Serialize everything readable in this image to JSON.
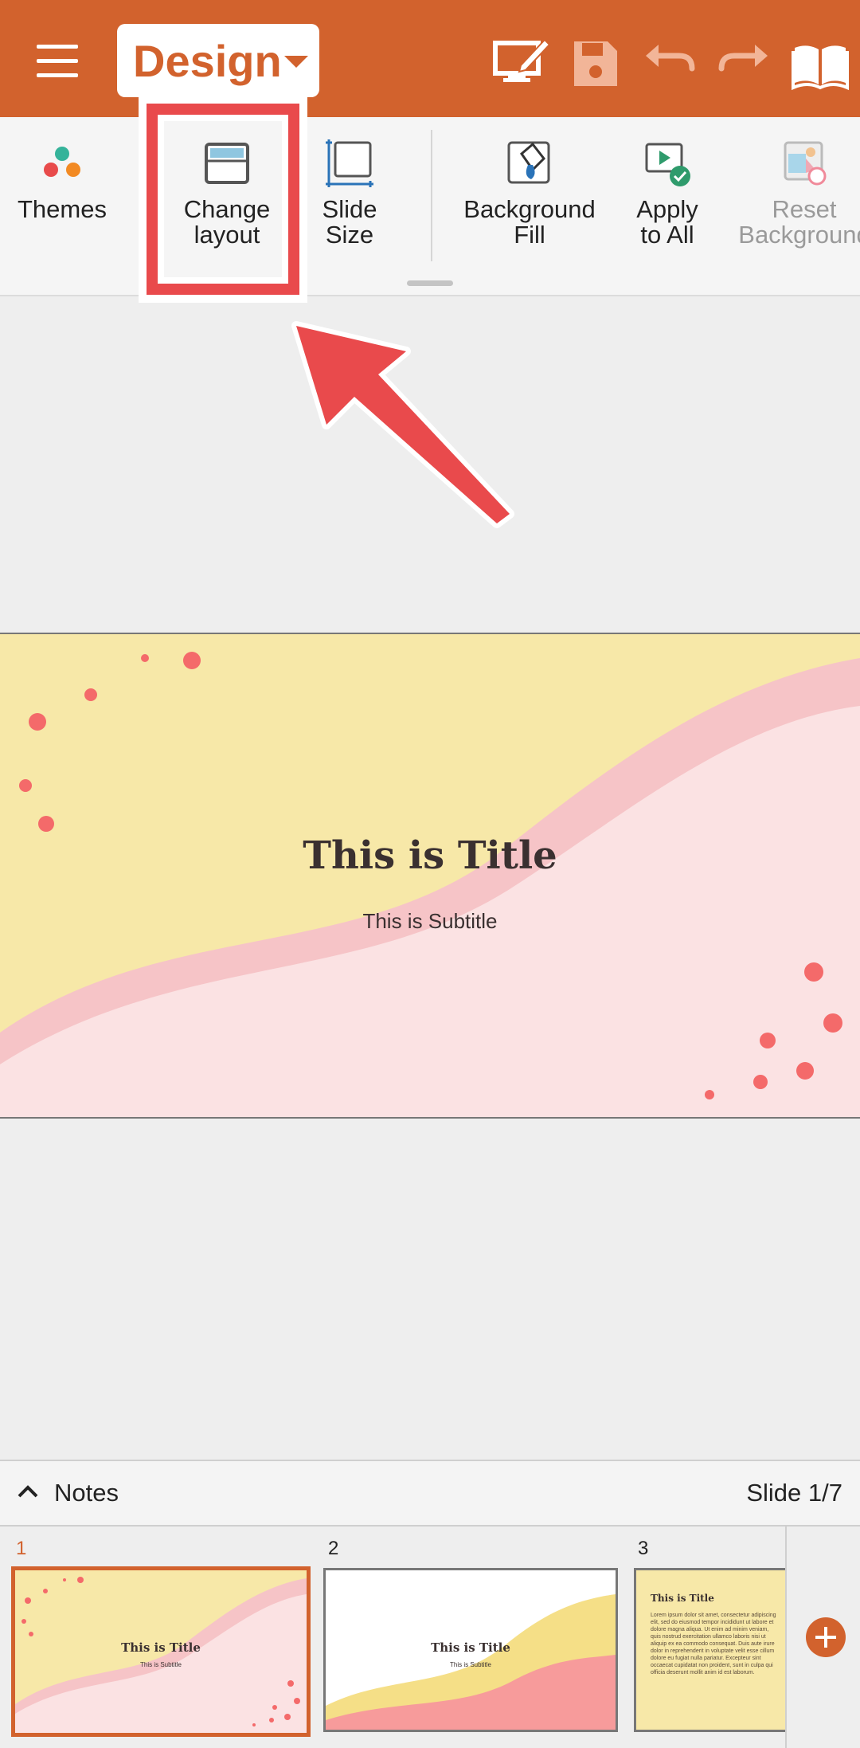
{
  "app": {
    "colors": {
      "accent": "#d2622d",
      "annotation": "#e94a4c",
      "slide_yellow": "#f7e8a8",
      "slide_pink": "#fbe2e3",
      "dot": "#f46a6a"
    }
  },
  "topbar": {
    "menu_icon": "hamburger-icon",
    "tab_label": "Design",
    "actions": [
      {
        "name": "edit-screen-icon"
      },
      {
        "name": "save-icon"
      },
      {
        "name": "undo-icon"
      },
      {
        "name": "redo-icon"
      },
      {
        "name": "book-icon"
      }
    ]
  },
  "ribbon": {
    "items": [
      {
        "label": "Themes",
        "icon": "themes-icon"
      },
      {
        "label": "Change\nlayout",
        "icon": "layout-icon"
      },
      {
        "label": "Slide\nSize",
        "icon": "slide-size-icon"
      },
      {
        "label": "Background\nFill",
        "icon": "background-fill-icon"
      },
      {
        "label": "Apply\nto All",
        "icon": "apply-to-all-icon"
      },
      {
        "label": "Reset\nBackground",
        "icon": "reset-background-icon",
        "disabled": true
      }
    ]
  },
  "slide": {
    "title": "This is Title",
    "subtitle": "This is Subtitle"
  },
  "notes_bar": {
    "label": "Notes",
    "counter": "Slide 1/7"
  },
  "thumbnails": [
    {
      "number": "1",
      "title": "This is Title",
      "subtitle": "This is Subtitle",
      "active": true
    },
    {
      "number": "2",
      "title": "This is Title",
      "subtitle": "This is Subtitle",
      "active": false
    },
    {
      "number": "3",
      "title": "This is Title",
      "body": "Lorem ipsum dolor sit amet, consectetur adipiscing elit, sed do eiusmod tempor incididunt ut labore et dolore magna aliqua. Ut enim ad minim veniam, quis nostrud exercitation ullamco laboris nisi ut aliquip ex ea commodo consequat. Duis aute irure dolor in reprehenderit in voluptate velit esse cillum dolore eu fugiat nulla pariatur. Excepteur sint occaecat cupidatat non proident, sunt in culpa qui officia deserunt mollit anim id est laborum.",
      "active": false
    }
  ]
}
